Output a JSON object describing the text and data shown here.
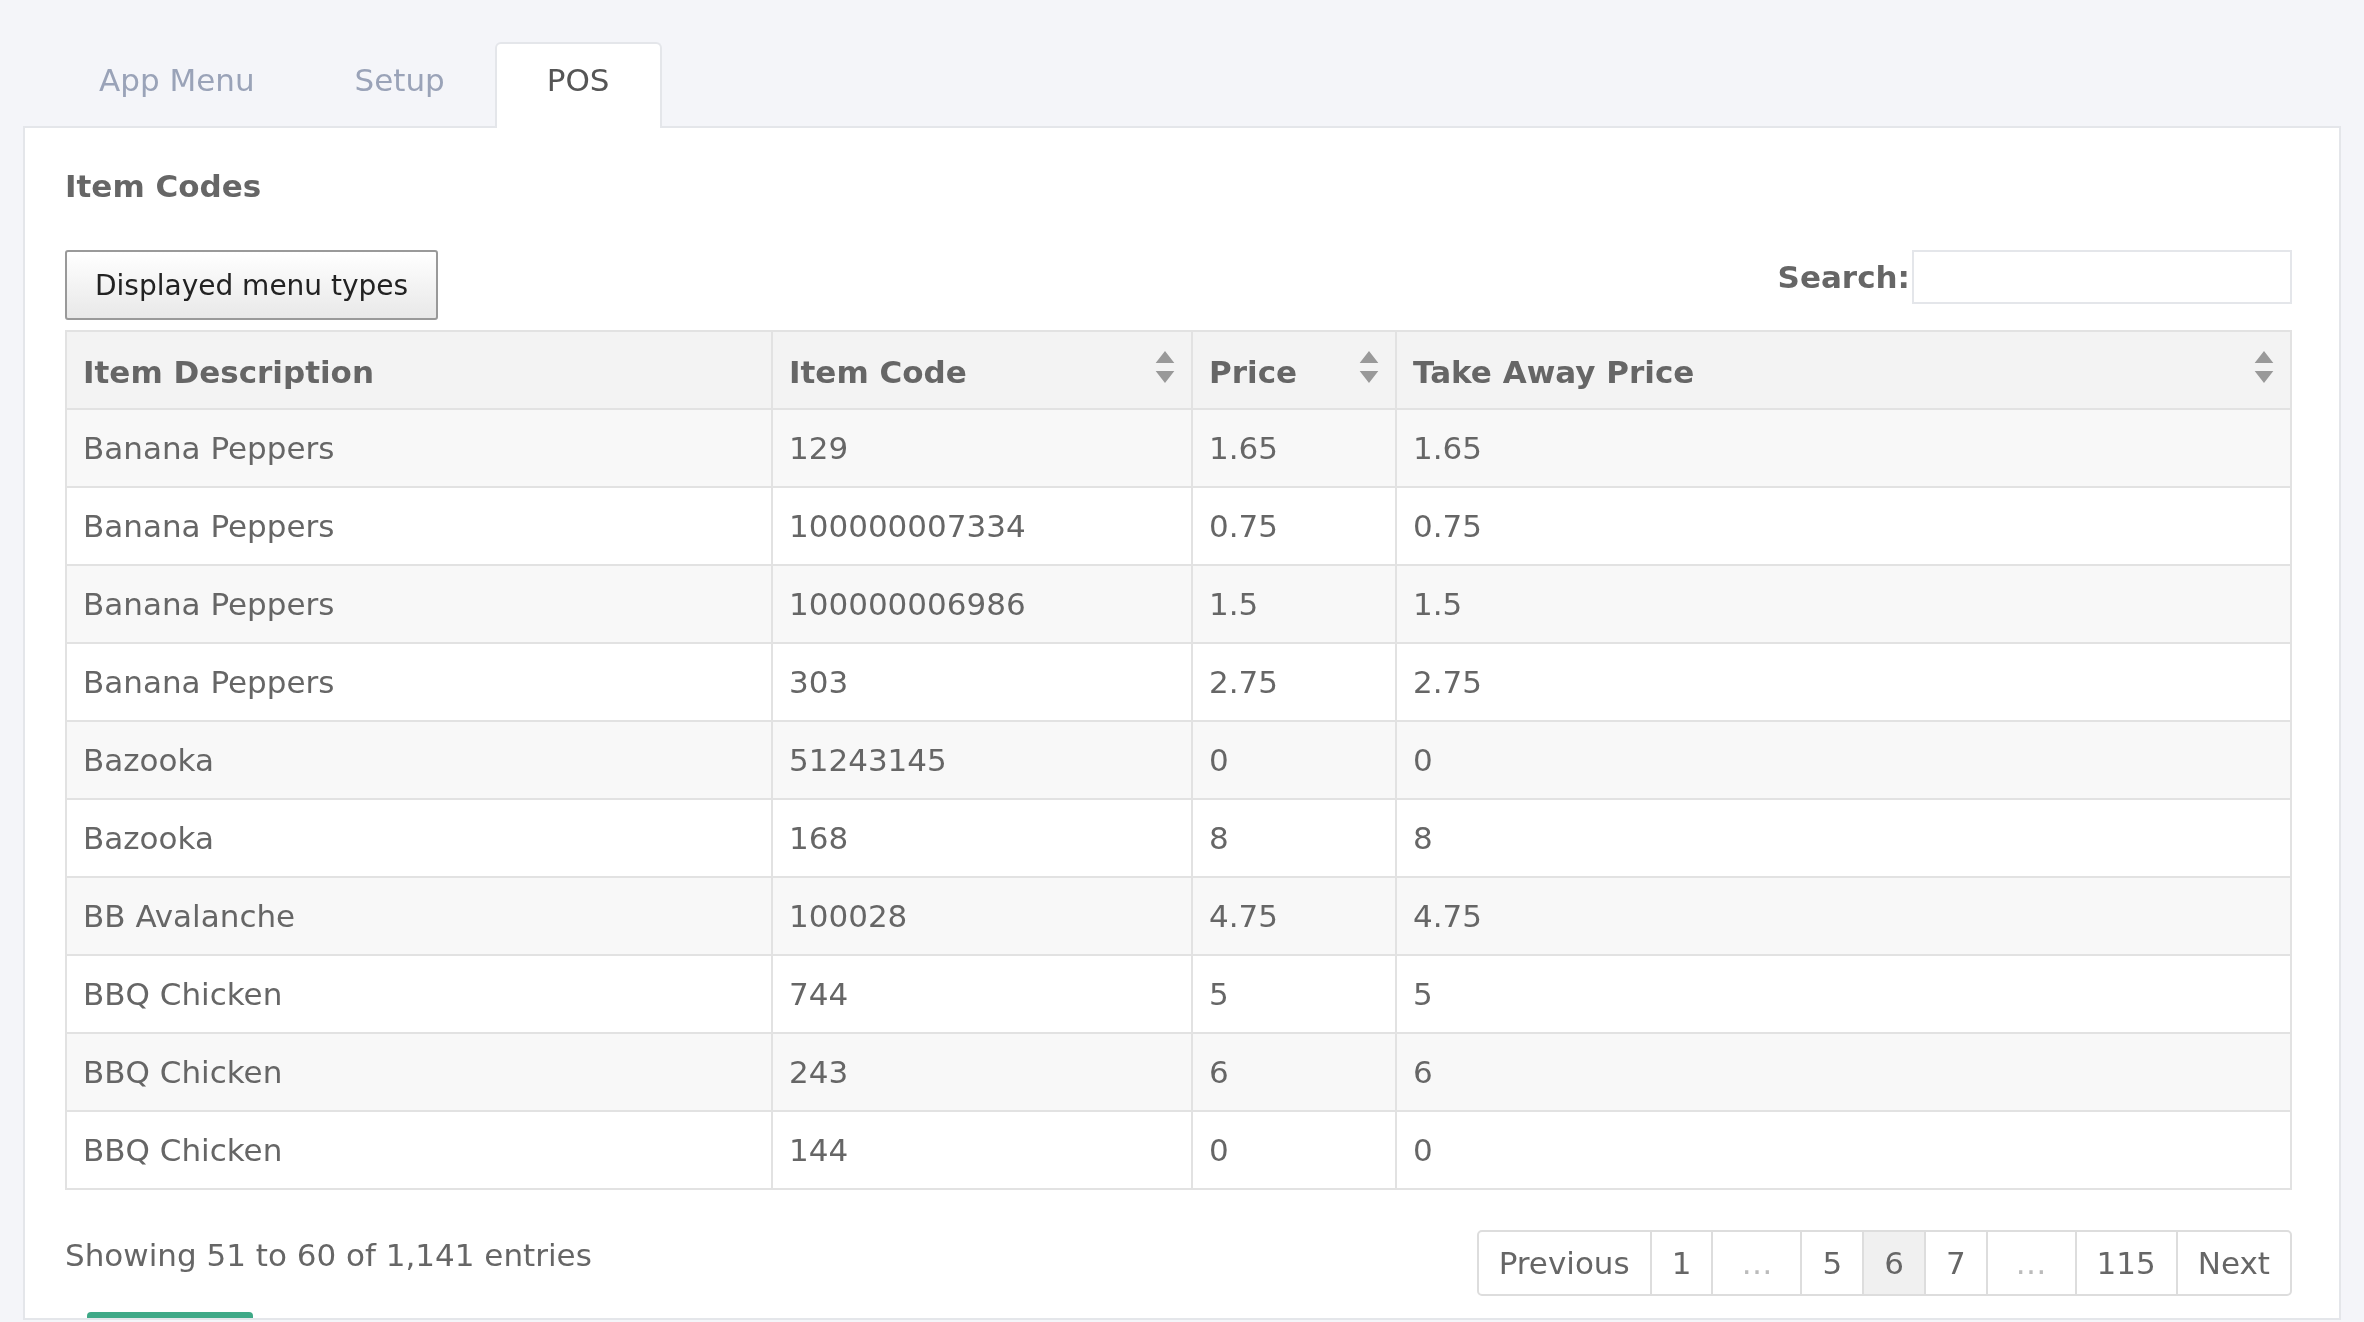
{
  "tabs": [
    {
      "label": "App Menu",
      "selected": false
    },
    {
      "label": "Setup",
      "selected": false
    },
    {
      "label": "POS",
      "selected": true
    }
  ],
  "panel": {
    "title": "Item Codes",
    "button": "Displayed menu types",
    "search": {
      "label": "Search:"
    }
  },
  "table": {
    "columns": [
      {
        "label": "Item Description",
        "sortable": false
      },
      {
        "label": "Item Code",
        "sortable": true
      },
      {
        "label": "Price",
        "sortable": true
      },
      {
        "label": "Take Away Price",
        "sortable": true
      }
    ],
    "rows": [
      [
        "Banana Peppers",
        "129",
        "1.65",
        "1.65"
      ],
      [
        "Banana Peppers",
        "100000007334",
        "0.75",
        "0.75"
      ],
      [
        "Banana Peppers",
        "100000006986",
        "1.5",
        "1.5"
      ],
      [
        "Banana Peppers",
        "303",
        "2.75",
        "2.75"
      ],
      [
        "Bazooka",
        "51243145",
        "0",
        "0"
      ],
      [
        "Bazooka",
        "168",
        "8",
        "8"
      ],
      [
        "BB Avalanche",
        "100028",
        "4.75",
        "4.75"
      ],
      [
        "BBQ Chicken",
        "744",
        "5",
        "5"
      ],
      [
        "BBQ Chicken",
        "243",
        "6",
        "6"
      ],
      [
        "BBQ Chicken",
        "144",
        "0",
        "0"
      ]
    ]
  },
  "info": "Showing 51 to 60 of 1,141 entries",
  "pagination": [
    {
      "kind": "nav",
      "label": "Previous",
      "selected": false
    },
    {
      "kind": "page",
      "label": "1",
      "selected": false
    },
    {
      "kind": "ellipsis",
      "label": "…",
      "selected": false
    },
    {
      "kind": "page",
      "label": "5",
      "selected": false
    },
    {
      "kind": "page",
      "label": "6",
      "selected": true
    },
    {
      "kind": "page",
      "label": "7",
      "selected": false
    },
    {
      "kind": "ellipsis",
      "label": "…",
      "selected": false
    },
    {
      "kind": "page",
      "label": "115",
      "selected": false
    },
    {
      "kind": "nav",
      "label": "Next",
      "selected": false
    }
  ]
}
